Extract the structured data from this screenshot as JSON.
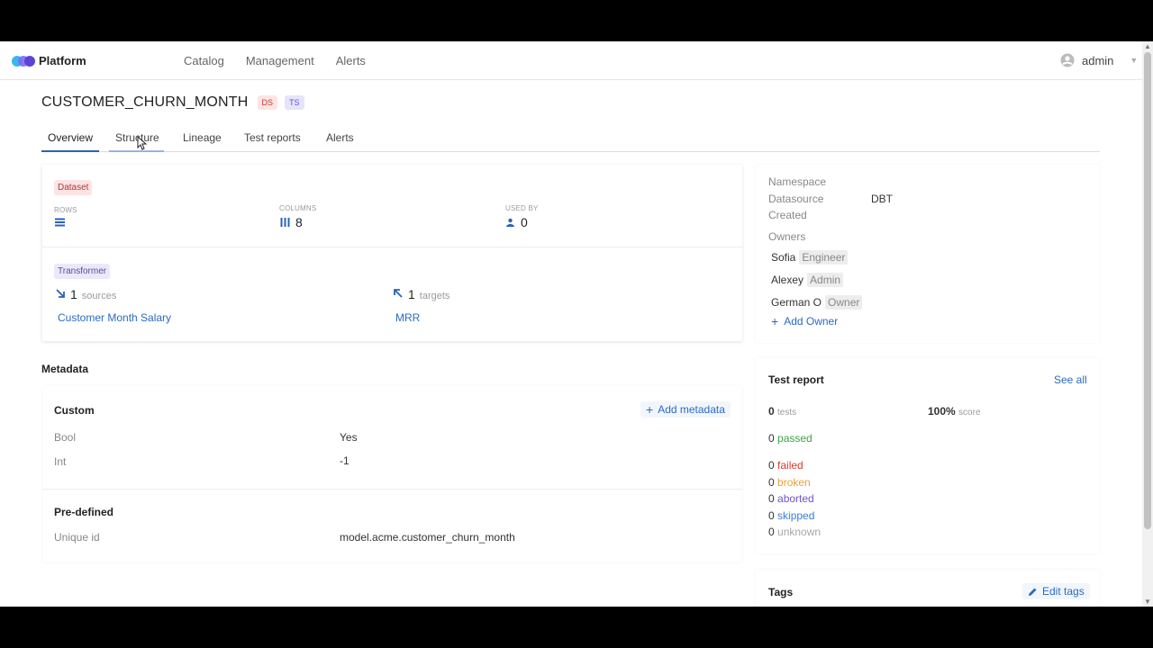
{
  "header": {
    "brand": "Platform",
    "nav": [
      "Catalog",
      "Management",
      "Alerts"
    ],
    "user": "admin"
  },
  "page": {
    "title": "CUSTOMER_CHURN_MONTH",
    "badges": [
      "DS",
      "TS"
    ],
    "tabs": [
      "Overview",
      "Structure",
      "Lineage",
      "Test reports",
      "Alerts"
    ]
  },
  "dataset": {
    "chip": "Dataset",
    "rows_label": "ROWS",
    "columns_label": "COLUMNS",
    "columns_value": "8",
    "used_by_label": "USED BY",
    "used_by_value": "0"
  },
  "transformer": {
    "chip": "Transformer",
    "sources_count": "1",
    "sources_label": "sources",
    "targets_count": "1",
    "targets_label": "targets",
    "source_link": "Customer Month Salary",
    "target_link": "MRR"
  },
  "info": {
    "namespace_label": "Namespace",
    "datasource_label": "Datasource",
    "datasource_value": "DBT",
    "created_label": "Created",
    "owners_label": "Owners",
    "owners": [
      {
        "name": "Sofia",
        "role": "Engineer"
      },
      {
        "name": "Alexey",
        "role": "Admin"
      },
      {
        "name": "German O",
        "role": "Owner"
      }
    ],
    "add_owner": "Add Owner"
  },
  "metadata": {
    "title": "Metadata",
    "custom_title": "Custom",
    "add_metadata": "Add metadata",
    "custom": [
      {
        "key": "Bool",
        "value": "Yes"
      },
      {
        "key": "Int",
        "value": "-1"
      }
    ],
    "predefined_title": "Pre-defined",
    "predefined": [
      {
        "key": "Unique id",
        "value": "model.acme.customer_churn_month"
      }
    ]
  },
  "test_report": {
    "title": "Test report",
    "see_all": "See all",
    "tests_count": "0",
    "tests_label": "tests",
    "score_value": "100%",
    "score_label": "score",
    "statuses": [
      {
        "count": "0",
        "label": "passed",
        "color": "#3aa541"
      },
      {
        "count": "0",
        "label": "failed",
        "color": "#d93a2f"
      },
      {
        "count": "0",
        "label": "broken",
        "color": "#e8a23a"
      },
      {
        "count": "0",
        "label": "aborted",
        "color": "#6f57c9"
      },
      {
        "count": "0",
        "label": "skipped",
        "color": "#3b7dd1"
      },
      {
        "count": "0",
        "label": "unknown",
        "color": "#a7a7a7"
      }
    ]
  },
  "tags": {
    "title": "Tags",
    "edit": "Edit tags"
  }
}
